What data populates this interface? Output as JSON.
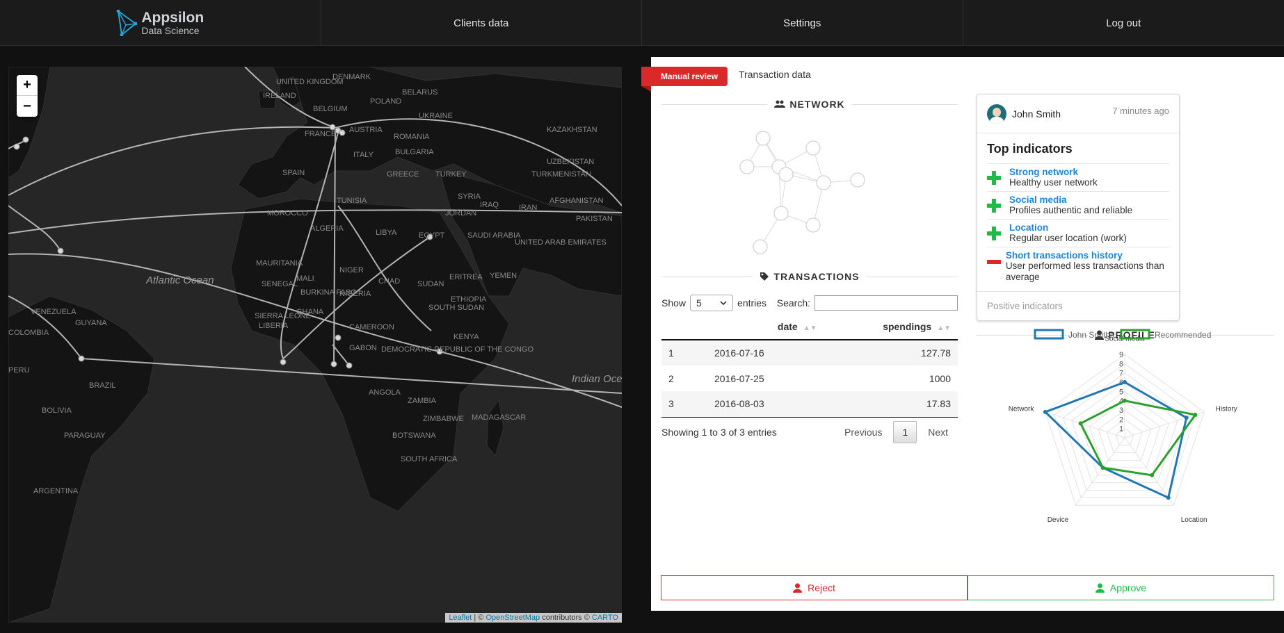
{
  "nav": {
    "logo_title": "Appsilon",
    "logo_subtitle": "Data Science",
    "items": [
      {
        "label": "Clients data"
      },
      {
        "label": "Settings"
      },
      {
        "label": "Log out"
      }
    ]
  },
  "map": {
    "zoom_in": "+",
    "zoom_out": "−",
    "labels": {
      "united_kingdom": "UNITED KINGDOM",
      "ireland": "IRELAND",
      "denmark": "DENMARK",
      "belarus": "BELARUS",
      "poland": "POLAND",
      "belgium": "BELGIUM",
      "ukraine": "UKRAINE",
      "france": "FRANCE",
      "austria": "AUSTRIA",
      "romania": "ROMANIA",
      "kazakhstan": "KAZAKHSTAN",
      "italy": "ITALY",
      "bulgaria": "BULGARIA",
      "uzbekistan": "UZBEKISTAN",
      "turkmenistan": "TURKMENISTAN",
      "spain": "SPAIN",
      "greece": "GREECE",
      "turkey": "TURKEY",
      "tunisia": "TUNISIA",
      "syria": "SYRIA",
      "afghanistan": "AFGHANISTAN",
      "iraq": "IRAQ",
      "iran": "IRAN",
      "morocco": "MOROCCO",
      "jordan": "JORDAN",
      "pakistan": "PAKISTAN",
      "algeria": "ALGERIA",
      "libya": "LIBYA",
      "egypt": "EGYPT",
      "saudi_arabia": "SAUDI ARABIA",
      "united_arab_emirates": "UNITED ARAB EMIRATES",
      "mauritania": "MAURITANIA",
      "niger": "NIGER",
      "mali": "MALI",
      "chad": "CHAD",
      "sudan": "SUDAN",
      "eritrea": "ERITREA",
      "yemen": "YEMEN",
      "atlantic_ocean": "Atlantic Ocean",
      "senegal": "SENEGAL",
      "burkina_faso": "BURKINA FASO",
      "nigeria": "NIGERIA",
      "ethiopia": "ETHIOPIA",
      "venezuela": "VENEZUELA",
      "guyana": "GUYANA",
      "ghana": "GHANA",
      "sierra_leone": "SIERRA LEONE",
      "liberia": "LIBERIA",
      "south_sudan": "SOUTH SUDAN",
      "cameroon": "CAMEROON",
      "colombia": "COLOMBIA",
      "kenya": "KENYA",
      "gabon": "GABON",
      "drc": "DEMOCRATIC REPUBLIC OF THE CONGO",
      "peru": "PERU",
      "brazil": "BRAZIL",
      "indian_ocean": "Indian Ocean",
      "angola": "ANGOLA",
      "zambia": "ZAMBIA",
      "bolivia": "BOLIVIA",
      "madagascar": "MADAGASCAR",
      "zimbabwe": "ZIMBABWE",
      "paraguay": "PARAGUAY",
      "botswana": "BOTSWANA",
      "south_africa": "SOUTH AFRICA",
      "argentina": "ARGENTINA"
    },
    "attribution": {
      "leaflet": "Leaflet",
      "sep": " | © ",
      "osm": "OpenStreetMap",
      "contrib": " contributors © ",
      "carto": "CARTO"
    }
  },
  "panel": {
    "ribbon": "Manual review",
    "tab2": "Transaction data",
    "network_title": "NETWORK",
    "transactions_title": "TRANSACTIONS",
    "profile_title": "PROFILE"
  },
  "table": {
    "show_label": "Show",
    "page_size": "5",
    "entries_label": "entries",
    "search_label": "Search:",
    "search_value": "",
    "columns": [
      "",
      "date",
      "spendings"
    ],
    "rows": [
      {
        "idx": "1",
        "date": "2016-07-16",
        "spendings": "127.78"
      },
      {
        "idx": "2",
        "date": "2016-07-25",
        "spendings": "1000"
      },
      {
        "idx": "3",
        "date": "2016-08-03",
        "spendings": "17.83"
      }
    ],
    "info": "Showing 1 to 3 of 3 entries",
    "previous": "Previous",
    "page": "1",
    "next": "Next"
  },
  "card": {
    "name": "John Smith",
    "time": "7 minutes ago",
    "title": "Top indicators",
    "indicators": [
      {
        "title": "Strong network",
        "desc": "Healthy user network",
        "sign": "plus"
      },
      {
        "title": "Social media",
        "desc": "Profiles authentic and reliable",
        "sign": "plus"
      },
      {
        "title": "Location",
        "desc": "Regular user location (work)",
        "sign": "plus"
      },
      {
        "title": "Short transactions history",
        "desc": "User performed less transactions than average",
        "sign": "minus"
      }
    ],
    "footer": "Positive indicators"
  },
  "chart_data": {
    "type": "radar",
    "axes": [
      "Social media",
      "History",
      "Location",
      "Device",
      "Network"
    ],
    "ticks": [
      "1",
      "2",
      "3",
      "4",
      "5",
      "6",
      "7",
      "8",
      "9"
    ],
    "range": [
      0,
      9
    ],
    "legend_position": "top",
    "series": [
      {
        "name": "John Smiths",
        "color": "#1f77b4",
        "values": [
          6,
          7,
          8,
          4,
          9
        ]
      },
      {
        "name": "Recommended",
        "color": "#2ca02c",
        "values": [
          4,
          8,
          5,
          4,
          5
        ]
      }
    ]
  },
  "actions": {
    "reject": "Reject",
    "approve": "Approve"
  },
  "colors": {
    "accent_red": "#db2828",
    "accent_green": "#21ba45",
    "link_blue": "#2185d0"
  }
}
